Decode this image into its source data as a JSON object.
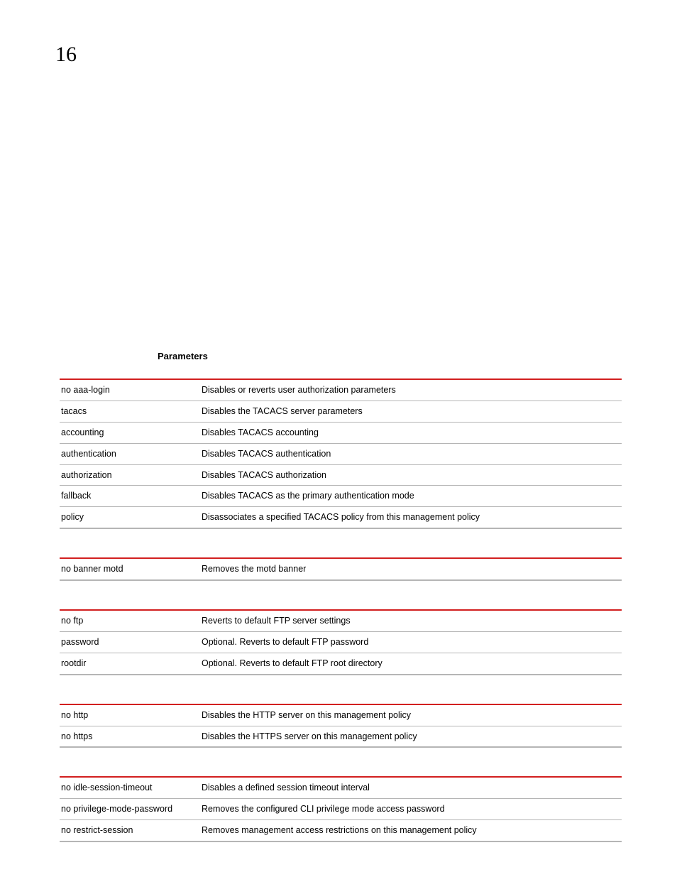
{
  "chapter_number": "16",
  "section_heading": "Parameters",
  "groups": [
    {
      "rows": [
        {
          "k": "no aaa-login",
          "v": "Disables or reverts user authorization parameters"
        },
        {
          "k": "tacacs",
          "v": "Disables the TACACS server parameters"
        },
        {
          "k": "accounting",
          "v": "Disables TACACS accounting"
        },
        {
          "k": "authentication",
          "v": "Disables TACACS authentication"
        },
        {
          "k": "authorization",
          "v": "Disables TACACS authorization"
        },
        {
          "k": "fallback",
          "v": "Disables TACACS as the primary authentication mode"
        },
        {
          "k": "policy",
          "v": "Disassociates a specified TACACS policy from this management policy"
        }
      ]
    },
    {
      "rows": [
        {
          "k": "no banner motd",
          "v": "Removes the motd banner"
        }
      ]
    },
    {
      "rows": [
        {
          "k": "no ftp",
          "v": "Reverts to default FTP server settings"
        },
        {
          "k": "password",
          "v": "Optional. Reverts to default FTP password"
        },
        {
          "k": "rootdir",
          "v": "Optional. Reverts to default FTP root directory"
        }
      ]
    },
    {
      "rows": [
        {
          "k": "no http",
          "v": "Disables the HTTP server on this management policy"
        },
        {
          "k": "no https",
          "v": "Disables the HTTPS server on this management policy"
        }
      ]
    },
    {
      "rows": [
        {
          "k": "no idle-session-timeout",
          "v": "Disables a defined session timeout interval"
        },
        {
          "k": "no privilege-mode-password",
          "v": "Removes the configured CLI privilege mode access password"
        },
        {
          "k": "no restrict-session",
          "v": "Removes management access restrictions on this management policy"
        }
      ]
    }
  ]
}
